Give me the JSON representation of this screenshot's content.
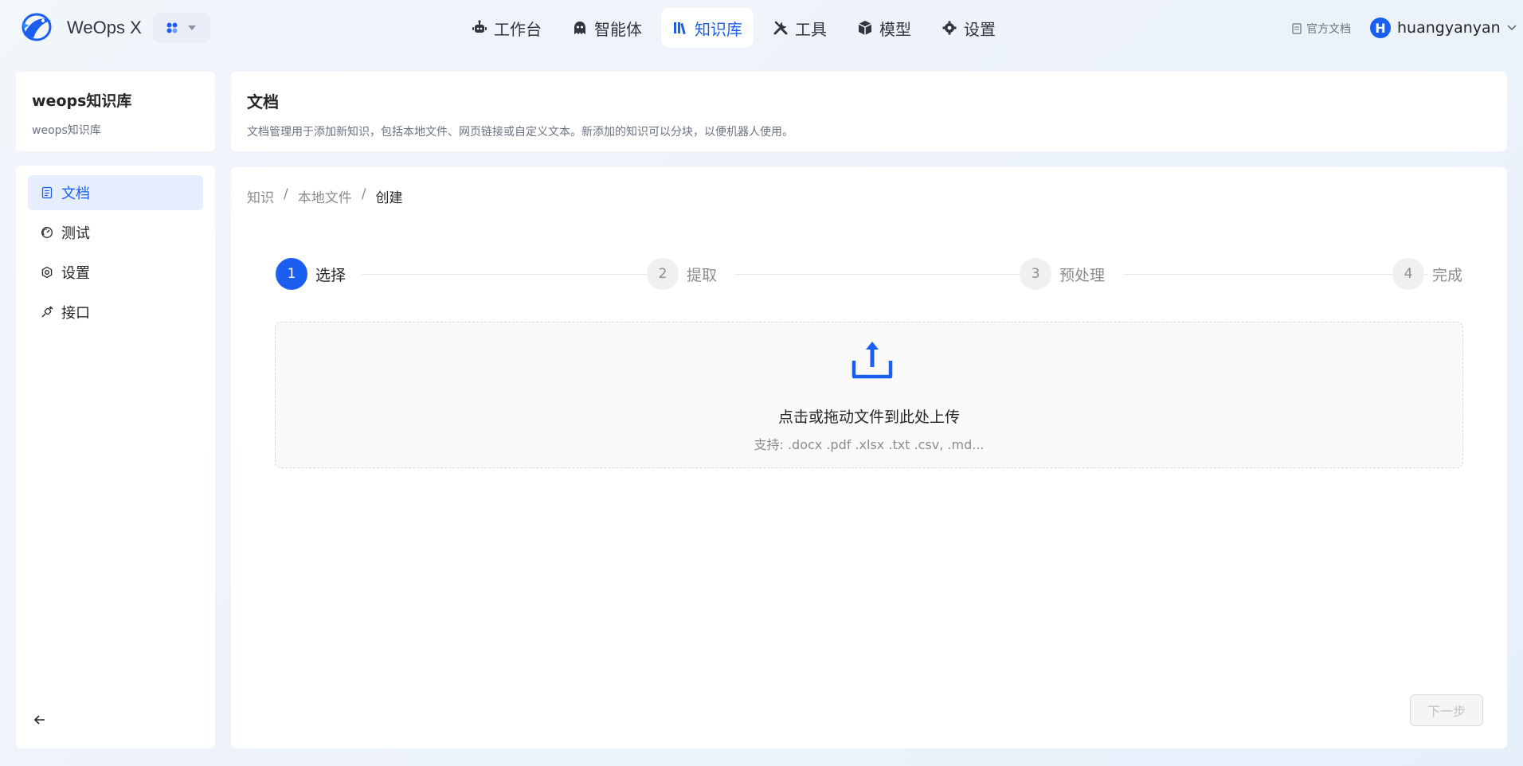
{
  "app": {
    "name": "WeOps X"
  },
  "nav": {
    "items": [
      {
        "label": "工作台",
        "icon": "robot-icon"
      },
      {
        "label": "智能体",
        "icon": "ghost-icon"
      },
      {
        "label": "知识库",
        "icon": "books-icon"
      },
      {
        "label": "工具",
        "icon": "tools-icon"
      },
      {
        "label": "模型",
        "icon": "cube-icon"
      },
      {
        "label": "设置",
        "icon": "gear-icon"
      }
    ],
    "active": "知识库"
  },
  "header_right": {
    "doc_link": "官方文档",
    "user_initial": "H",
    "username": "huangyanyan"
  },
  "knowledge_base": {
    "title": "weops知识库",
    "subtitle": "weops知识库"
  },
  "sidebar": {
    "items": [
      {
        "label": "文档",
        "icon": "document-icon"
      },
      {
        "label": "测试",
        "icon": "gauge-icon"
      },
      {
        "label": "设置",
        "icon": "gear-icon"
      },
      {
        "label": "接口",
        "icon": "plug-icon"
      }
    ],
    "active": "文档"
  },
  "page_header": {
    "title": "文档",
    "description": "文档管理用于添加新知识，包括本地文件、网页链接或自定义文本。新添加的知识可以分块，以便机器人使用。"
  },
  "breadcrumb": {
    "items": [
      "知识",
      "本地文件",
      "创建"
    ],
    "separator": "/"
  },
  "steps": [
    {
      "number": "1",
      "label": "选择"
    },
    {
      "number": "2",
      "label": "提取"
    },
    {
      "number": "3",
      "label": "预处理"
    },
    {
      "number": "4",
      "label": "完成"
    }
  ],
  "upload": {
    "title": "点击或拖动文件到此处上传",
    "hint": "支持: .docx .pdf .xlsx .txt .csv, .md..."
  },
  "actions": {
    "next_label": "下一步"
  },
  "colors": {
    "accent": "#1a5ff0",
    "active_bg": "#e6eefd"
  }
}
